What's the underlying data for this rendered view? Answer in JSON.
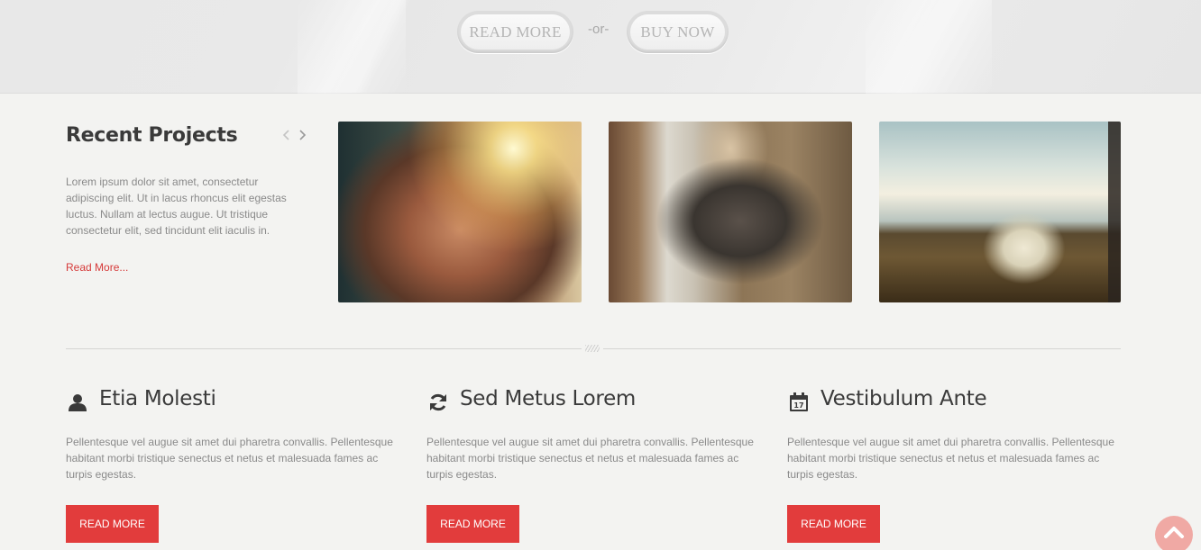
{
  "banner": {
    "read_more_label": "READ MORE",
    "or_label": "-or-",
    "buy_now_label": "BUY NOW"
  },
  "recent_projects": {
    "title": "Recent Projects",
    "prev_icon": "chevron-left-icon",
    "next_icon": "chevron-right-icon",
    "description": "Lorem ipsum dolor sit amet, consectetur adipiscing elit. Ut in lacus rhoncus elit egestas luctus. Nullam at lectus augue. Ut tristique consectetur elit, sed tincidunt elit iaculis in.",
    "read_more_link": "Read More..."
  },
  "features": [
    {
      "icon": "user-icon",
      "title": "Etia Molesti",
      "text": "Pellentesque vel augue sit amet dui pharetra convallis. Pellentesque habitant morbi tristique senectus et netus et malesuada fames ac turpis egestas.",
      "button": "READ MORE"
    },
    {
      "icon": "refresh-icon",
      "title": "Sed Metus Lorem",
      "text": "Pellentesque vel augue sit amet dui pharetra convallis. Pellentesque habitant morbi tristique senectus et netus et malesuada fames ac turpis egestas.",
      "button": "READ MORE"
    },
    {
      "icon": "calendar-icon",
      "title": "Vestibulum Ante",
      "calendar_day": "17",
      "text": "Pellentesque vel augue sit amet dui pharetra convallis. Pellentesque habitant morbi tristique senectus et netus et malesuada fames ac turpis egestas.",
      "button": "READ MORE"
    }
  ],
  "colors": {
    "accent": "#e23c3c",
    "link": "#d63a3a",
    "scroll_top": "#f0a9a4"
  }
}
